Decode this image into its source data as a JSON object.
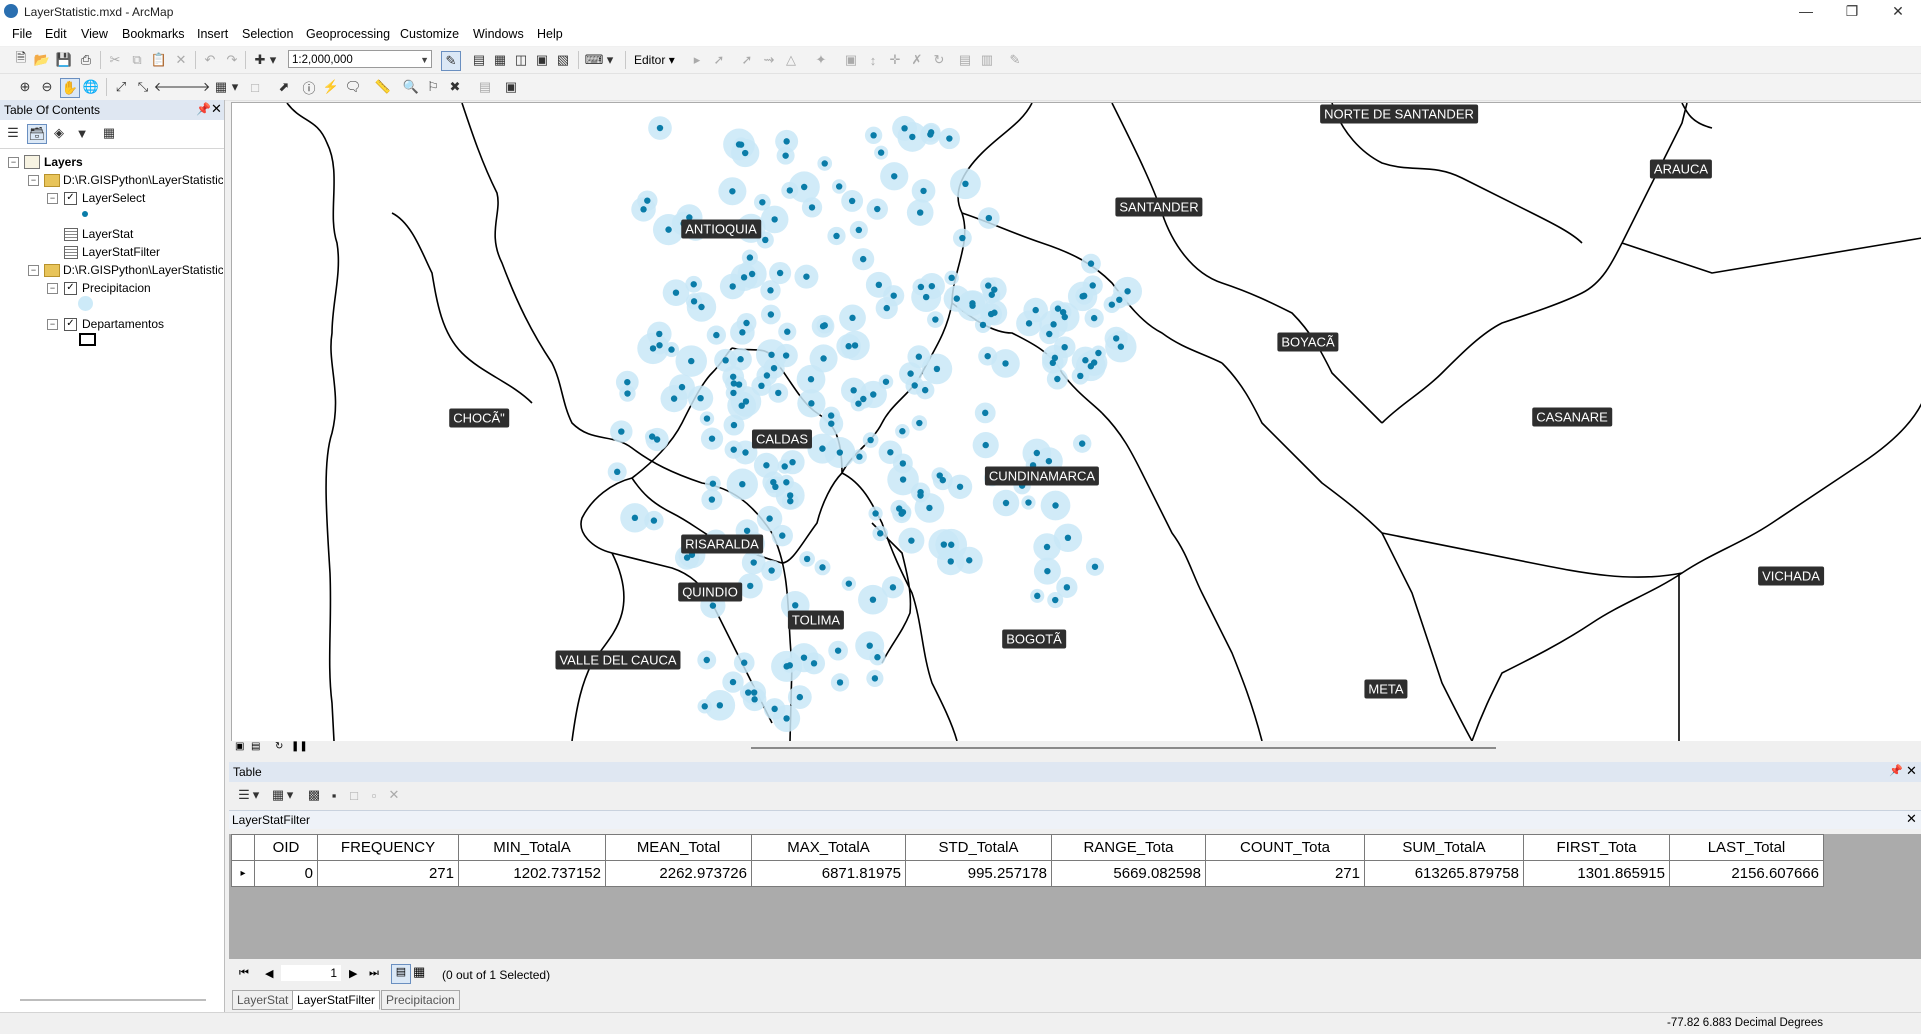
{
  "window": {
    "title": "LayerStatistic.mxd - ArcMap"
  },
  "menu": [
    "File",
    "Edit",
    "View",
    "Bookmarks",
    "Insert",
    "Selection",
    "Geoprocessing",
    "Customize",
    "Windows",
    "Help"
  ],
  "toolbar": {
    "scale": "1:2,000,000",
    "editor_label": "Editor"
  },
  "toc": {
    "title": "Table Of Contents",
    "root": "Layers",
    "group1": "D:\\R.GISPython\\LayerStatistic\\",
    "layer_select": "LayerSelect",
    "layer_stat": "LayerStat",
    "layer_stat_filter": "LayerStatFilter",
    "group2": "D:\\R.GISPython\\LayerStatistic\\",
    "precipitacion": "Precipitacion",
    "departamentos": "Departamentos"
  },
  "map": {
    "labels": {
      "norte_santander": "NORTE DE SANTANDER",
      "arauca": "ARAUCA",
      "antioquia": "ANTIOQUIA",
      "santander": "SANTANDER",
      "boyaca": "BOYACÃ",
      "choco": "CHOCÃ\"",
      "caldas": "CALDAS",
      "casanare": "CASANARE",
      "cundinamarca": "CUNDINAMARCA",
      "risaralda": "RISARALDA",
      "vichada": "VICHADA",
      "quindio": "QUINDIO",
      "tolima": "TOLIMA",
      "bogota": "BOGOTÃ",
      "valle": "VALLE DEL CAUCA",
      "meta": "META"
    }
  },
  "table": {
    "window_title": "Table",
    "grid_title": "LayerStatFilter",
    "columns": [
      "OID",
      "FREQUENCY",
      "MIN_TotalA",
      "MEAN_Total",
      "MAX_TotalA",
      "STD_TotalA",
      "RANGE_Tota",
      "COUNT_Tota",
      "SUM_TotalA",
      "FIRST_Tota",
      "LAST_Total"
    ],
    "row": [
      "0",
      "271",
      "1202.737152",
      "2262.973726",
      "6871.81975",
      "995.257178",
      "5669.082598",
      "271",
      "613265.879758",
      "1301.865915",
      "2156.607666"
    ],
    "record_number": "1",
    "selection_status": "(0 out of 1 Selected)",
    "tabs": [
      "LayerStat",
      "LayerStatFilter",
      "Precipitacion"
    ]
  },
  "status": {
    "coords": "-77.82  6.883 Decimal Degrees"
  }
}
